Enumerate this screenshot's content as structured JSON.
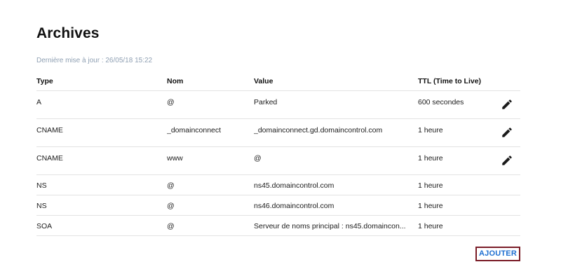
{
  "page": {
    "title": "Archives",
    "last_update": "Dernière mise à jour : 26/05/18 15:22"
  },
  "table": {
    "headers": {
      "type": "Type",
      "name": "Nom",
      "value": "Value",
      "ttl": "TTL (Time to Live)"
    },
    "rows": [
      {
        "type": "A",
        "name": "@",
        "value": "Parked",
        "ttl": "600 secondes",
        "editable": true
      },
      {
        "type": "CNAME",
        "name": "_domainconnect",
        "value": "_domainconnect.gd.domaincontrol.com",
        "ttl": "1 heure",
        "editable": true
      },
      {
        "type": "CNAME",
        "name": "www",
        "value": "@",
        "ttl": "1 heure",
        "editable": true
      },
      {
        "type": "NS",
        "name": "@",
        "value": "ns45.domaincontrol.com",
        "ttl": "1 heure",
        "editable": false
      },
      {
        "type": "NS",
        "name": "@",
        "value": "ns46.domaincontrol.com",
        "ttl": "1 heure",
        "editable": false
      },
      {
        "type": "SOA",
        "name": "@",
        "value": "Serveur de noms principal : ns45.domaincon...",
        "ttl": "1 heure",
        "editable": false
      }
    ]
  },
  "actions": {
    "add_label": "AJOUTER"
  },
  "icons": {
    "edit": "pencil-icon"
  },
  "colors": {
    "add_text": "#1f6fd1",
    "add_border": "#7a1c27",
    "muted_text": "#8fa0b3",
    "divider": "#e3e3e3"
  }
}
